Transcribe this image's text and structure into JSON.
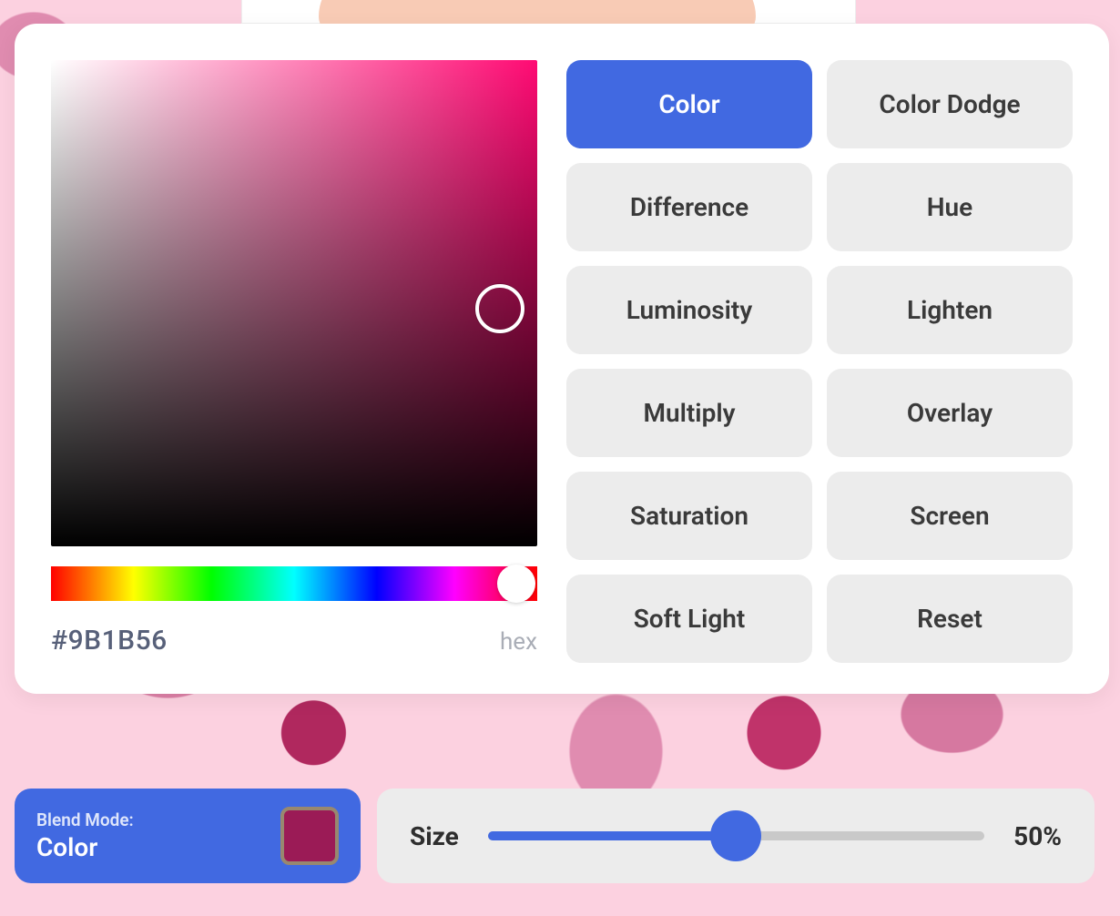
{
  "color_picker": {
    "hex_value": "#9B1B56",
    "hex_label": "hex",
    "hue_color": "#ff0a73"
  },
  "blend_modes": [
    {
      "label": "Color",
      "active": true
    },
    {
      "label": "Color Dodge",
      "active": false
    },
    {
      "label": "Difference",
      "active": false
    },
    {
      "label": "Hue",
      "active": false
    },
    {
      "label": "Luminosity",
      "active": false
    },
    {
      "label": "Lighten",
      "active": false
    },
    {
      "label": "Multiply",
      "active": false
    },
    {
      "label": "Overlay",
      "active": false
    },
    {
      "label": "Saturation",
      "active": false
    },
    {
      "label": "Screen",
      "active": false
    },
    {
      "label": "Soft Light",
      "active": false
    },
    {
      "label": "Reset",
      "active": false
    }
  ],
  "blend_chip": {
    "label": "Blend Mode:",
    "value": "Color",
    "swatch_color": "#9B1B56"
  },
  "size": {
    "label": "Size",
    "percent": 50,
    "display": "50%"
  }
}
